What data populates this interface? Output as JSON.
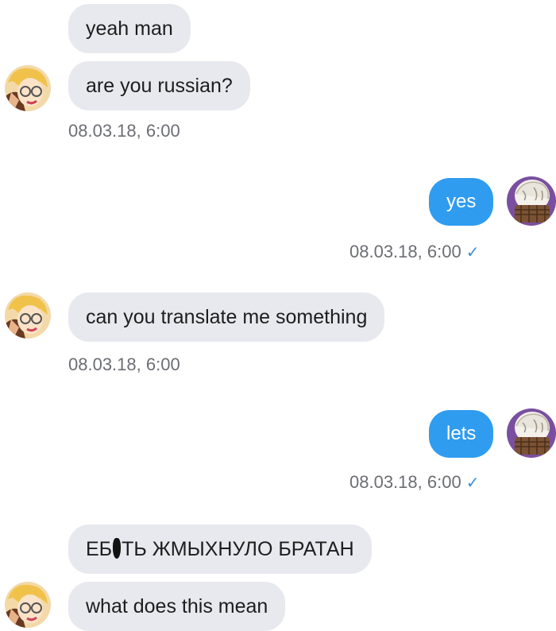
{
  "conversation": {
    "messages": [
      {
        "text": "yeah man",
        "direction": "incoming"
      },
      {
        "text": "are you russian?",
        "direction": "incoming",
        "timestamp": "08.03.18, 6:00"
      },
      {
        "text": "yes",
        "direction": "outgoing",
        "timestamp": "08.03.18, 6:00",
        "status": "✓"
      },
      {
        "text": "can you translate me something",
        "direction": "incoming",
        "timestamp": "08.03.18, 6:00"
      },
      {
        "text": "lets",
        "direction": "outgoing",
        "timestamp": "08.03.18, 6:00",
        "status": "✓"
      },
      {
        "text_before": "ЕБ",
        "text_after": "ТЬ ЖМЫХНУЛО БРАТАН",
        "censored": true,
        "direction": "incoming"
      },
      {
        "text": "what does this mean",
        "direction": "incoming"
      }
    ]
  },
  "colors": {
    "incoming_bubble": "#e8e9ee",
    "outgoing_bubble": "#2f9cf0",
    "timestamp": "#6c6e73",
    "read_check": "#3a8fdc"
  },
  "icons": {
    "incoming_avatar": "anime-character-avatar",
    "outgoing_avatar": "scarf-character-avatar",
    "read_status": "check-icon"
  }
}
